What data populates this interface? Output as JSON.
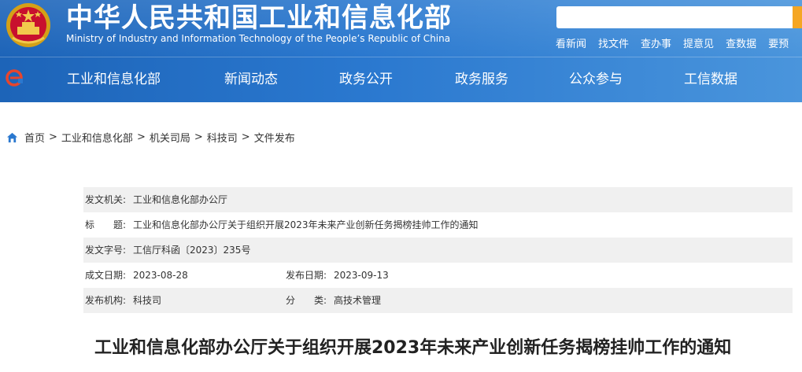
{
  "header": {
    "ministry_cn": "中华人民共和国工业和信息化部",
    "ministry_en": "Ministry of Industry and Information Technology of the People’s Republic of China",
    "search": {
      "placeholder": ""
    },
    "quick_links": [
      "看新闻",
      "找文件",
      "查办事",
      "提意见",
      "查数据",
      "要预"
    ]
  },
  "nav": {
    "items": [
      "工业和信息化部",
      "新闻动态",
      "政务公开",
      "政务服务",
      "公众参与",
      "工信数据"
    ]
  },
  "breadcrumb": {
    "items": [
      "首页",
      "工业和信息化部",
      "机关司局",
      "科技司",
      "文件发布"
    ],
    "separator": ">"
  },
  "meta": {
    "issuer_label": "发文机关:",
    "issuer": "工业和信息化部办公厅",
    "title_label": "标　　题:",
    "title": "工业和信息化部办公厅关于组织开展2023年未来产业创新任务揭榜挂帅工作的通知",
    "doc_no_label": "发文字号:",
    "doc_no": "工信厅科函〔2023〕235号",
    "created_label": "成文日期:",
    "created": "2023-08-28",
    "published_label": "发布日期:",
    "published": "2023-09-13",
    "org_label": "发布机构:",
    "org": "科技司",
    "category_label": "分　　类:",
    "category": "高技术管理"
  },
  "doc_title": "工业和信息化部办公厅关于组织开展2023年未来产业创新任务揭榜挂帅工作的通知",
  "colors": {
    "header_blue": "#2a78cf",
    "search_button": "#f5a623",
    "row_shade": "#f0f0f0"
  }
}
